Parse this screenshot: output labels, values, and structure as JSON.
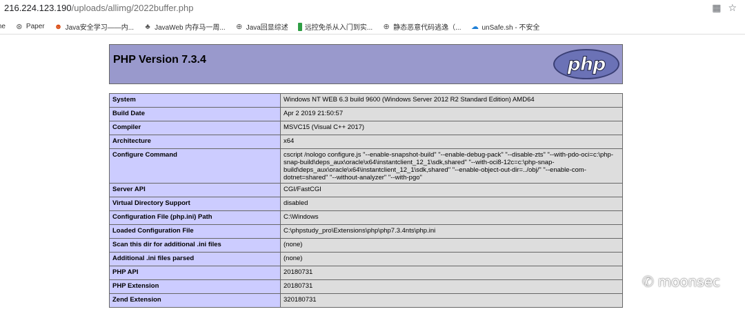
{
  "browser": {
    "url_host": "216.224.123.190",
    "url_path": "/uploads/allimg/2022buffer.php"
  },
  "bookmarks": [
    {
      "label": "me",
      "icon": "blank"
    },
    {
      "label": "Paper",
      "icon": "globe-icon"
    },
    {
      "label": "Java安全学习——内...",
      "icon": "mascot-icon"
    },
    {
      "label": "JavaWeb 内存马一周...",
      "icon": "tree-icon"
    },
    {
      "label": "Java回显综述",
      "icon": "globe-icon"
    },
    {
      "label": "远控免杀从入门到实...",
      "icon": "green-bar-icon"
    },
    {
      "label": "静态恶意代码逃逸（...",
      "icon": "globe-icon"
    },
    {
      "label": "unSafe.sh - 不安全",
      "icon": "cloud-icon"
    }
  ],
  "php": {
    "version_title": "PHP Version 7.3.4",
    "logo_text": "php",
    "rows": [
      {
        "key": "System",
        "value": "Windows NT WEB 6.3 build 9600 (Windows Server 2012 R2 Standard Edition) AMD64"
      },
      {
        "key": "Build Date",
        "value": "Apr 2 2019 21:50:57"
      },
      {
        "key": "Compiler",
        "value": "MSVC15 (Visual C++ 2017)"
      },
      {
        "key": "Architecture",
        "value": "x64"
      },
      {
        "key": "Configure Command",
        "value": "cscript /nologo configure.js \"--enable-snapshot-build\" \"--enable-debug-pack\" \"--disable-zts\" \"--with-pdo-oci=c:\\php-snap-build\\deps_aux\\oracle\\x64\\instantclient_12_1\\sdk,shared\" \"--with-oci8-12c=c:\\php-snap-build\\deps_aux\\oracle\\x64\\instantclient_12_1\\sdk,shared\" \"--enable-object-out-dir=../obj/\" \"--enable-com-dotnet=shared\" \"--without-analyzer\" \"--with-pgo\""
      },
      {
        "key": "Server API",
        "value": "CGI/FastCGI"
      },
      {
        "key": "Virtual Directory Support",
        "value": "disabled"
      },
      {
        "key": "Configuration File (php.ini) Path",
        "value": "C:\\Windows"
      },
      {
        "key": "Loaded Configuration File",
        "value": "C:\\phpstudy_pro\\Extensions\\php\\php7.3.4nts\\php.ini"
      },
      {
        "key": "Scan this dir for additional .ini files",
        "value": "(none)"
      },
      {
        "key": "Additional .ini files parsed",
        "value": "(none)"
      },
      {
        "key": "PHP API",
        "value": "20180731"
      },
      {
        "key": "PHP Extension",
        "value": "20180731"
      },
      {
        "key": "Zend Extension",
        "value": "320180731"
      }
    ]
  },
  "watermark": "moonsec",
  "colors": {
    "header_bg": "#9999cc",
    "key_cell_bg": "#ccccff",
    "value_cell_bg": "#dddddd"
  }
}
